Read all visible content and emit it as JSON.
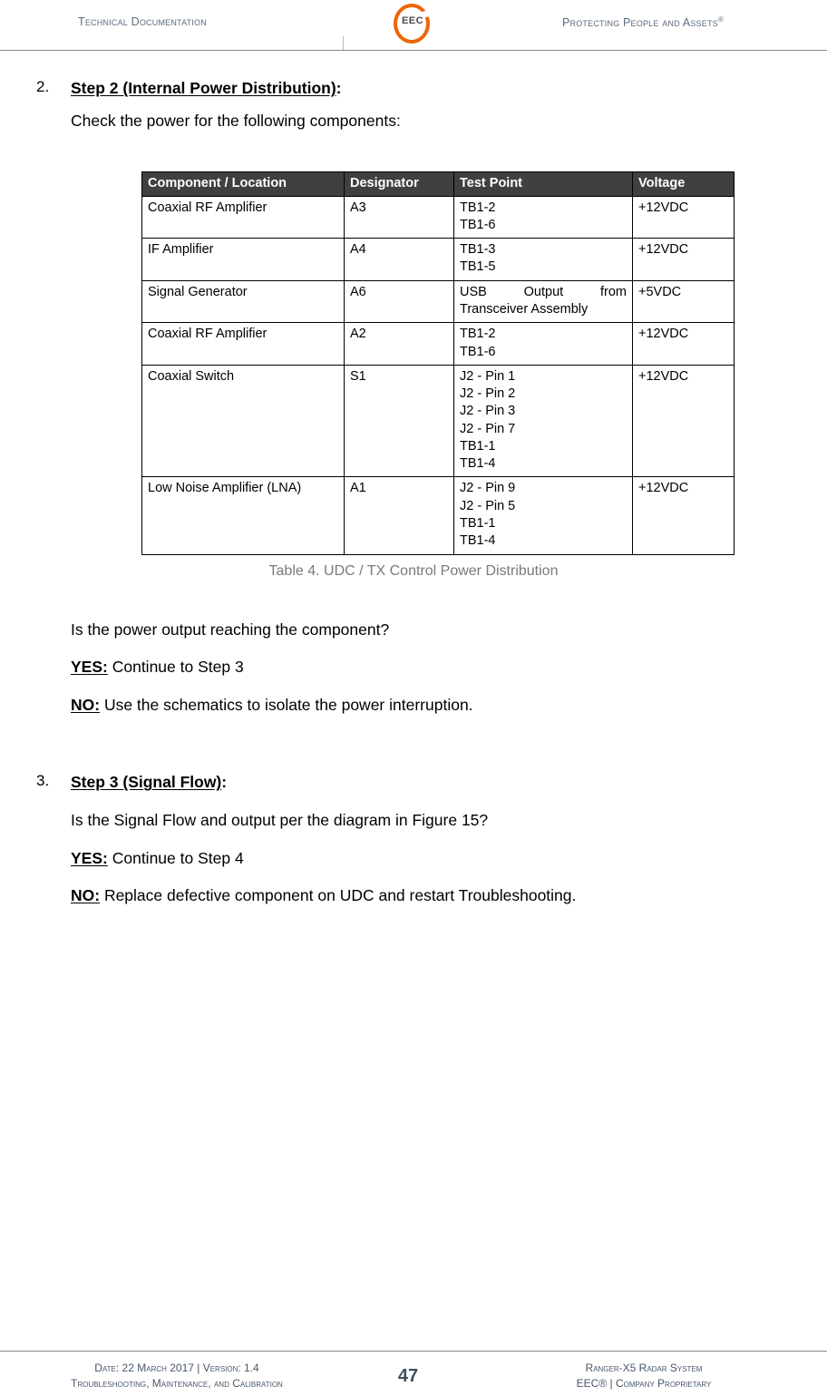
{
  "header": {
    "left_text": "Technical Documentation",
    "right_text": "Protecting People and Assets",
    "right_superscript": "®",
    "logo_mark": "EEC",
    "logo_color": "#ec6608",
    "text_color": "#5b6b7d"
  },
  "body": {
    "step2": {
      "number": "2.",
      "title_underlined": "Step 2 (Internal Power Distribution)",
      "title_colon": ":",
      "intro": "Check the power for the following components:"
    },
    "table": {
      "header_bg": "#404040",
      "columns": [
        "Component / Location",
        "Designator",
        "Test Point",
        "Voltage"
      ],
      "rows": [
        {
          "component": "Coaxial RF Amplifier",
          "designator": "A3",
          "test_point": [
            "TB1-2",
            "TB1-6"
          ],
          "voltage": "+12VDC"
        },
        {
          "component": "IF Amplifier",
          "designator": "A4",
          "test_point": [
            "TB1-3",
            "TB1-5"
          ],
          "voltage": "+12VDC"
        },
        {
          "component": "Signal Generator",
          "designator": "A6",
          "test_point": [
            "USB Output from",
            "Transceiver Assembly"
          ],
          "voltage": "+5VDC"
        },
        {
          "component": "Coaxial RF Amplifier",
          "designator": "A2",
          "test_point": [
            "TB1-2",
            "TB1-6"
          ],
          "voltage": "+12VDC"
        },
        {
          "component": "Coaxial Switch",
          "designator": "S1",
          "test_point": [
            "J2 - Pin 1",
            "J2 - Pin 2",
            "J2 - Pin 3",
            "J2 - Pin 7",
            "TB1-1",
            "TB1-4"
          ],
          "voltage": "+12VDC"
        },
        {
          "component": "Low Noise Amplifier (LNA)",
          "designator": "A1",
          "test_point": [
            "J2 - Pin 9",
            "J2 - Pin 5",
            "TB1-1",
            "TB1-4"
          ],
          "voltage": "+12VDC"
        }
      ],
      "caption": "Table 4. UDC / TX Control Power Distribution",
      "caption_color": "#7a7a7a"
    },
    "step2_followup": {
      "question": "Is the power output reaching the component?",
      "yes_label": "YES:",
      "yes_text": " Continue to Step 3",
      "no_label": "NO:",
      "no_text": " Use the schematics to isolate the power interruption."
    },
    "step3": {
      "number": "3.",
      "title_underlined": "Step 3 (Signal Flow)",
      "title_colon": ":",
      "question": "Is the Signal Flow and output per the diagram in Figure 15?",
      "yes_label": "YES:",
      "yes_text": " Continue to Step 4",
      "no_label": "NO:",
      "no_text": " Replace defective component on UDC and restart Troubleshooting."
    }
  },
  "footer": {
    "left_line1": "Date: 22 March 2017 | Version: 1.4",
    "left_line2": "Troubleshooting, Maintenance, and Calibration",
    "page_number": "47",
    "right_line1": "Ranger-X5 Radar System",
    "right_line2": "EEC® | Company Proprietary",
    "text_color": "#48586a"
  }
}
